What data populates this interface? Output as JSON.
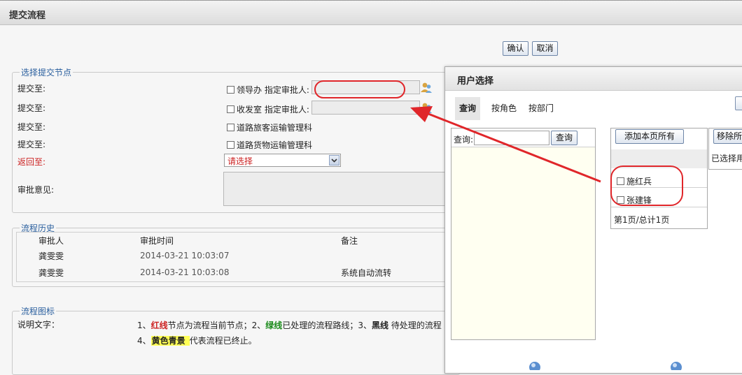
{
  "page": {
    "title": "提交流程"
  },
  "actions": {
    "confirm": "确认",
    "cancel": "取消"
  },
  "select_node": {
    "legend": "选择提交节点",
    "rows": [
      {
        "label": "提交至:",
        "option": "领导办 指定审批人:"
      },
      {
        "label": "提交至:",
        "option": "收发室 指定审批人:"
      },
      {
        "label": "提交至:",
        "option": "道路旅客运输管理科"
      },
      {
        "label": "提交至:",
        "option": "道路货物运输管理科"
      }
    ],
    "return_label": "返回至:",
    "return_select": "请选择",
    "opinion_label": "审批意见:"
  },
  "history": {
    "legend": "流程历史",
    "headers": [
      "审批人",
      "审批时间",
      "备注"
    ],
    "rows": [
      [
        "龚雯雯",
        "2014-03-21 10:03:07",
        ""
      ],
      [
        "龚雯雯",
        "2014-03-21 10:03:08",
        "系统自动流转"
      ]
    ]
  },
  "diagram": {
    "legend": "流程图标",
    "desc_label": "说明文字：",
    "line1": {
      "p1": "1、",
      "red": "红线",
      "p2": "节点为流程当前节点；2、",
      "green": "绿线",
      "p3": "已处理的流程路线；3、",
      "black": "黑线",
      "p4": " 待处理的流程"
    },
    "line2": {
      "p1": "4、",
      "yellow": "黄色青景",
      "p2": "代表流程已终止。"
    }
  },
  "dialog": {
    "title": "用户选择",
    "tabs": [
      "查询",
      "按角色",
      "按部门"
    ],
    "query_label": "查询:",
    "query_button": "查询",
    "add_all": "添加本页所有",
    "users": [
      "施红兵",
      "张建锋"
    ],
    "pagination": "第1页/总计1页",
    "remove_button": "移除所",
    "selected_label": "已选择用"
  },
  "colors": {
    "red": "#cc2222",
    "green": "#1a8a1a",
    "legend": "#2a5f9e",
    "highlight": "#ffff55",
    "annotation": "#e0262a"
  }
}
